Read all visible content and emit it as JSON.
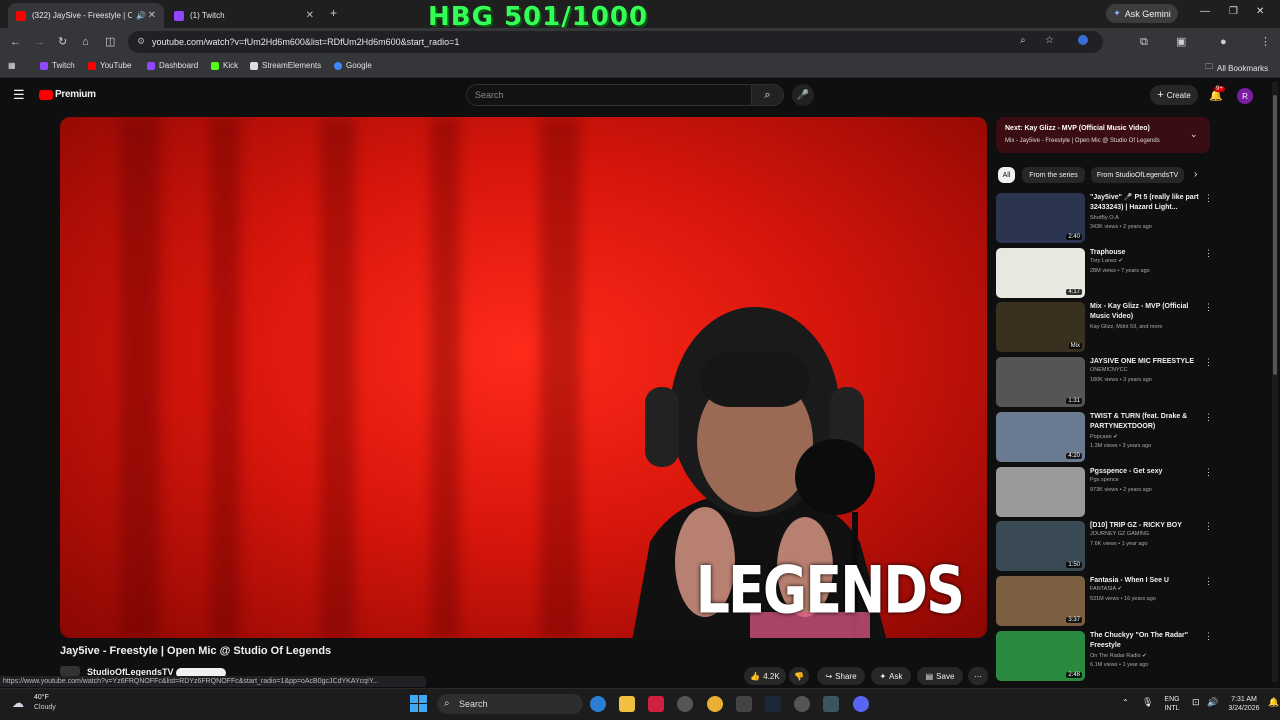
{
  "browser": {
    "tabs": [
      {
        "title": "(322) JaySive - Freestyle | O",
        "active": true
      },
      {
        "title": "(1) Twitch",
        "active": false
      }
    ],
    "overlay_text": "HBG 501/1000",
    "ask_gemini": "Ask Gemini",
    "url": "youtube.com/watch?v=fUm2Hd6m600&list=RDfUm2Hd6m600&start_radio=1",
    "bookmarks": [
      "Twitch",
      "YouTube",
      "Dashboard",
      "Kick",
      "StreamElements",
      "Google"
    ],
    "all_bookmarks": "All Bookmarks",
    "status_url": "https://www.youtube.com/watch?v=Yz6FRQNOFFc&list=RDYz6FRQNOFFc&start_radio=1&pp=oAcB0gcJCdYKAYcqIY..."
  },
  "youtube": {
    "logo": "Premium",
    "search_placeholder": "Search",
    "create": "Create",
    "notif_count": "9+",
    "avatar_letter": "R",
    "video_title": "Jay5ive - Freestyle | Open Mic @ Studio Of Legends",
    "channel": "StudioOfLegendsTV",
    "watermark": "LEGENDS",
    "actions": {
      "likes": "4.2K",
      "share": "Share",
      "ask": "Ask",
      "save": "Save"
    },
    "next": {
      "title": "Next: Kay Glizz - MVP (Official Music Video)",
      "subtitle": "Mix - Jay5ive - Freestyle | Open Mic @ Studio Of Legends"
    },
    "chips": [
      "All",
      "From the series",
      "From StudioOfLegendsTV"
    ],
    "recommendations": [
      {
        "title": "\"Jay5ive\" 🎤 Pt 5 (really like part 32433243) | Hazard Light...",
        "channel": "ShotBy O.A",
        "meta": "343K views • 2 years ago",
        "duration": "2:40",
        "color": "#2b3550"
      },
      {
        "title": "Traphouse",
        "channel": "Tory Lanez ✔",
        "meta": "28M views • 7 years ago",
        "duration": "4:17",
        "color": "#e8e8e0"
      },
      {
        "title": "Mix - Kay Glizz - MVP (Official Music Video)",
        "channel": "Kay Glizz, Mdot 59, and more",
        "meta": "",
        "duration": "Mix",
        "color": "#3a3020"
      },
      {
        "title": "JAYSIVE ONE MIC FREESTYLE",
        "channel": "ONEMICNYCC",
        "meta": "180K views • 3 years ago",
        "duration": "1:31",
        "color": "#555555"
      },
      {
        "title": "TWIST & TURN (feat. Drake & PARTYNEXTDOOR)",
        "channel": "Popcaan ✔",
        "meta": "1.3M views • 3 years ago",
        "duration": "4:20",
        "color": "#6a7a90"
      },
      {
        "title": "Pgsspence - Get sexy",
        "channel": "Pgs spence",
        "meta": "973K views • 2 years ago",
        "duration": "",
        "color": "#9a9a9a"
      },
      {
        "title": "[D10] TRIP GZ - RICKY BOY",
        "channel": "JOURNEY GZ GAMING",
        "meta": "7.6K views • 1 year ago",
        "duration": "1:50",
        "color": "#3a4a55"
      },
      {
        "title": "Fantasia - When I See U",
        "channel": "FANTASIA ✔",
        "meta": "531M views • 16 years ago",
        "duration": "3:37",
        "color": "#7a6040"
      },
      {
        "title": "The Chuckyy \"On The Radar\" Freestyle",
        "channel": "On The Radar Radio ✔",
        "meta": "6.1M views • 1 year ago",
        "duration": "2:48",
        "color": "#2a8a40"
      }
    ]
  },
  "taskbar": {
    "weather_temp": "40°F",
    "weather_desc": "Cloudy",
    "search": "Search",
    "lang_top": "ENG",
    "lang_bottom": "INTL",
    "time": "7:31 AM",
    "date": "3/24/2026"
  }
}
